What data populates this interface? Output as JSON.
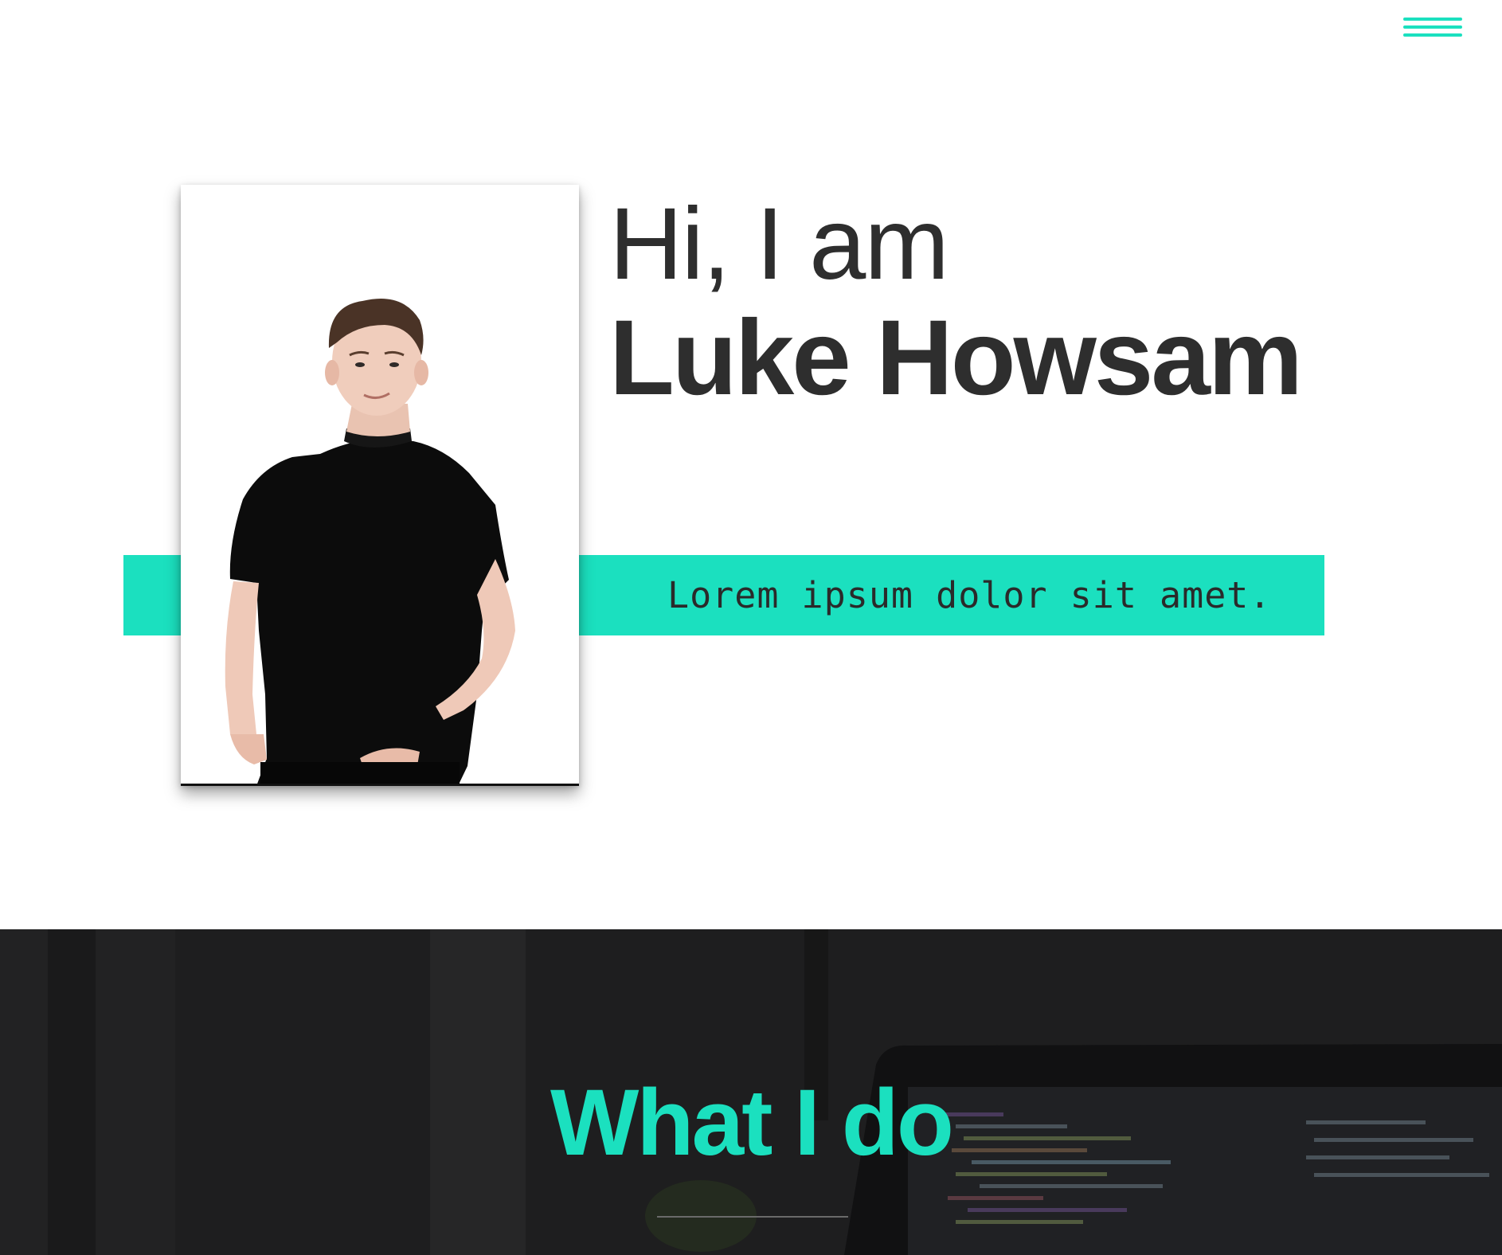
{
  "colors": {
    "accent": "#1be0bf",
    "text_dark": "#2e2e2e",
    "section_bg": "#1e1e1f"
  },
  "nav": {
    "menu_icon": "hamburger-menu-icon"
  },
  "hero": {
    "greeting": "Hi, I am",
    "name": "Luke Howsam",
    "tagline": "Lorem ipsum dolor sit amet.",
    "photo_alt": "Portrait of a young man in a black t-shirt"
  },
  "section": {
    "title": "What I do"
  }
}
